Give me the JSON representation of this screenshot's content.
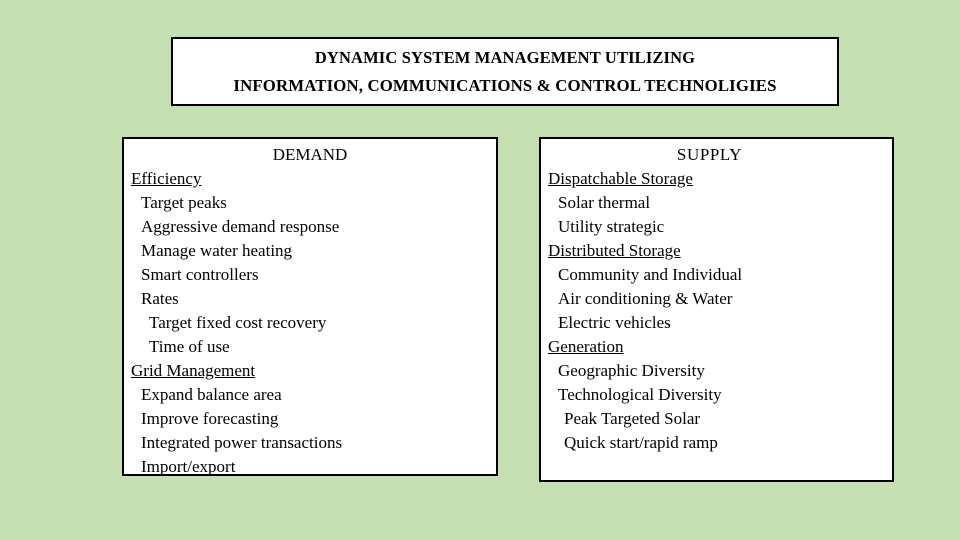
{
  "slide": {
    "background_color": "#c6dfb2",
    "panel_background_color": "#ffffff",
    "border_color": "#000000"
  },
  "title": {
    "line1": "DYNAMIC SYSTEM MANAGEMENT UTILIZING",
    "line2": "INFORMATION, COMMUNICATIONS & CONTROL TECHNOLIGIES"
  },
  "demand": {
    "heading": "DEMAND",
    "items": [
      {
        "text": "Efficiency",
        "level": 0,
        "category": true
      },
      {
        "text": "Target peaks",
        "level": 1,
        "category": false
      },
      {
        "text": "Aggressive demand response",
        "level": 1,
        "category": false
      },
      {
        "text": "Manage water heating",
        "level": 1,
        "category": false
      },
      {
        "text": "Smart controllers",
        "level": 1,
        "category": false
      },
      {
        "text": "Rates",
        "level": 1,
        "category": false
      },
      {
        "text": "Target fixed cost recovery",
        "level": 2,
        "category": false
      },
      {
        "text": "Time of use",
        "level": 2,
        "category": false
      },
      {
        "text": "Grid Management",
        "level": 0,
        "category": true
      },
      {
        "text": "Expand balance area",
        "level": 1,
        "category": false
      },
      {
        "text": "Improve forecasting",
        "level": 1,
        "category": false
      },
      {
        "text": "Integrated power transactions",
        "level": 1,
        "category": false
      },
      {
        "text": "Import/export",
        "level": 1,
        "category": false
      }
    ]
  },
  "supply": {
    "heading": "SUPPLY",
    "items": [
      {
        "text": "Dispatchable Storage",
        "level": 0,
        "category": true
      },
      {
        "text": "Solar thermal",
        "level": 1,
        "category": false
      },
      {
        "text": "Utility strategic",
        "level": 1,
        "category": false
      },
      {
        "text": "Distributed Storage",
        "level": 0,
        "category": true
      },
      {
        "text": "Community and Individual",
        "level": 1,
        "category": false
      },
      {
        "text": "Air conditioning & Water",
        "level": 1,
        "category": false
      },
      {
        "text": "Electric vehicles",
        "level": 1,
        "category": false
      },
      {
        "text": "Generation",
        "level": 0,
        "category": true
      },
      {
        "text": "Geographic Diversity",
        "level": 1,
        "category": false
      },
      {
        "text": "Technological Diversity",
        "level": 1,
        "category": false
      },
      {
        "text": "Peak Targeted Solar",
        "level": 2,
        "category": false
      },
      {
        "text": "Quick start/rapid ramp",
        "level": 2,
        "category": false
      }
    ]
  }
}
